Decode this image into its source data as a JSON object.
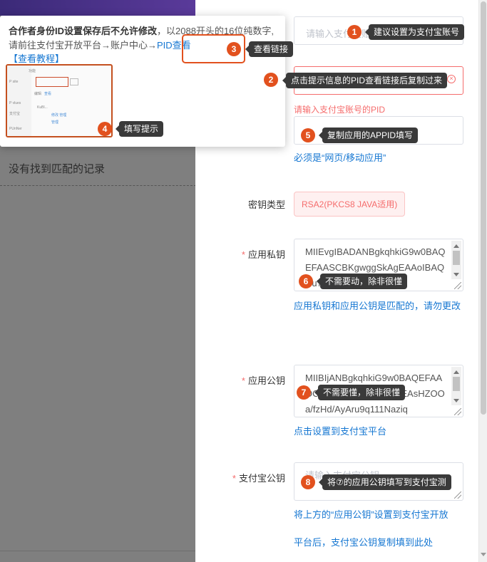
{
  "background": {
    "empty_text": "没有找到匹配的记录"
  },
  "popover": {
    "title_bold": "合作者身份ID设置保存后不允许修改",
    "title_rest": "，以2088开头的16位纯数字,请前往支付宝开放平台→账户中心→",
    "pid_link": "PID查看",
    "tutorial_link": "【查看教程】",
    "thumb_labels": [
      "功能",
      "P site",
      "P vlues",
      "支付宝",
      "编辑",
      "查看",
      "KuBl...",
      "修改 管理",
      "管理",
      "PUnNer"
    ]
  },
  "form": {
    "pid": {
      "placeholder": "请输入支付宝账号"
    },
    "pid_required_msg": "请输入支付宝账号的PID",
    "appid_hint": "必须是“网页/移动应用”",
    "key_type": {
      "label": "密钥类型",
      "value": "RSA2(PKCS8 JAVA适用)"
    },
    "private_key": {
      "label": "应用私钥",
      "value": "MIIEvgIBADANBgkqhkiG9w0BAQEFAASCBKgwggSkAgEAAoIBAQCu72rX",
      "hint": "应用私钥和应用公钥是匹配的，请勿更改"
    },
    "public_key": {
      "label": "应用公钥",
      "value": "MIIBIjANBgkqhkiG9w0BAQEFAAOCAQ8AMIIBCgKCAQEAsHZOOa/fzHd/AyAru9q111Naziq",
      "hint": "点击设置到支付宝平台"
    },
    "alipay_key": {
      "label": "支付宝公钥",
      "placeholder": "请输入支付宝公钥",
      "hint_line1": "将上方的“应用公钥”设置到支付宝开放",
      "hint_line2": "平台后，支付宝公钥复制填到此处"
    }
  },
  "annotations": [
    {
      "num": "1",
      "text": "建议设置为支付宝账号"
    },
    {
      "num": "2",
      "text": "点击提示信息的PID查看链接后复制过来"
    },
    {
      "num": "3",
      "text": "查看链接"
    },
    {
      "num": "4",
      "text": "填写提示"
    },
    {
      "num": "5",
      "text": "复制应用的APPID填写"
    },
    {
      "num": "6",
      "text": "不需要动，除非很懂"
    },
    {
      "num": "7",
      "text": "不需要懂，除非很懂"
    },
    {
      "num": "8",
      "text": "将⑦的应用公钥填写到支付宝测"
    }
  ],
  "colors": {
    "annotation_badge": "#e2511e",
    "link_blue": "#1677d2",
    "error_red": "#f56c6c"
  }
}
